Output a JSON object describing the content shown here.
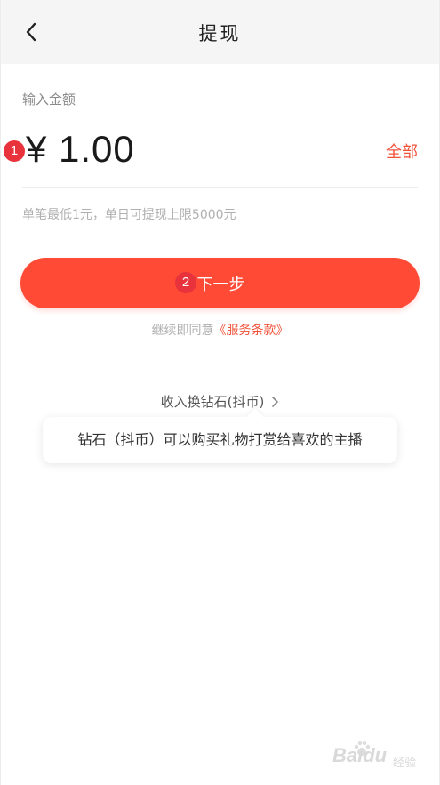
{
  "header": {
    "title": "提现",
    "back_icon": "chevron-left-icon"
  },
  "amount": {
    "label": "输入金额",
    "value": "¥ 1.00",
    "all_label": "全部",
    "limit_hint": "单笔最低1元，单日可提现上限5000元"
  },
  "badges": {
    "first": "1",
    "second": "2"
  },
  "actions": {
    "next_label": "下一步",
    "agree_prefix": "继续即同意",
    "terms_link": "《服务条款》"
  },
  "exchange": {
    "label": "收入换钻石(抖币)",
    "tooltip": "钻石（抖币）可以购买礼物打赏给喜欢的主播"
  },
  "watermark": {
    "logo": "Baidu",
    "sub": "经验"
  },
  "colors": {
    "accent": "#ff4a36",
    "link": "#f0533a",
    "badge": "#e8323c",
    "header_bg": "#f5f5f5"
  }
}
